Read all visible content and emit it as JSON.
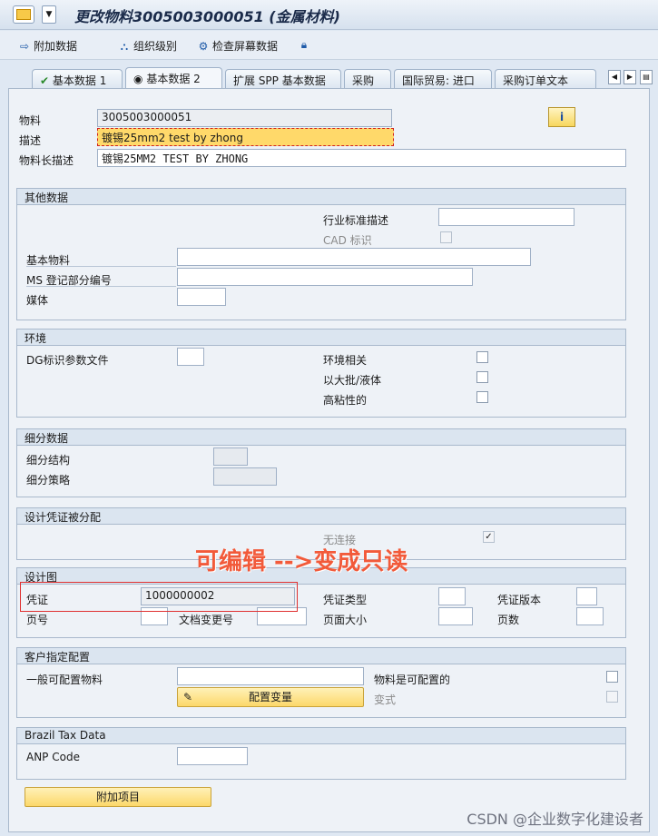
{
  "window": {
    "title": "更改物料3005003000051 (金属材料)"
  },
  "toolbar": {
    "items": [
      {
        "label": "附加数据",
        "icon": "arrow-right-icon"
      },
      {
        "label": "组织级别",
        "icon": "hierarchy-icon"
      },
      {
        "label": "检查屏幕数据",
        "icon": "check-screen-icon"
      },
      {
        "label": "",
        "icon": "lock-icon"
      }
    ]
  },
  "tabs": [
    "基本数据 1",
    "基本数据 2",
    "扩展 SPP 基本数据",
    "采购",
    "国际贸易: 进口",
    "采购订单文本"
  ],
  "header": {
    "material_label": "物料",
    "material_value": "3005003000051",
    "desc_label": "描述",
    "desc_value": "镀锡25mm2 test by zhong",
    "longdesc_label": "物料长描述",
    "longdesc_value": "镀锡25MM2 TEST BY ZHONG"
  },
  "other": {
    "title": "其他数据",
    "industry_desc": "行业标准描述",
    "cad": "CAD 标识",
    "base_material": "基本物料",
    "ms_part": "MS 登记部分编号",
    "medium": "媒体"
  },
  "env": {
    "title": "环境",
    "dg": "DG标识参数文件",
    "env_rel": "环境相关",
    "liquid": "以大批/液体",
    "viscous": "高粘性的"
  },
  "segment": {
    "title": "细分数据",
    "structure": "细分结构",
    "strategy": "细分策略"
  },
  "design_doc": {
    "title": "设计凭证被分配",
    "no_link": "无连接",
    "no_link_checked": "✓"
  },
  "drawing": {
    "title": "设计图",
    "doc": "凭证",
    "doc_value": "1000000002",
    "doc_type": "凭证类型",
    "doc_version": "凭证版本",
    "page_no": "页号",
    "change_no": "文档变更号",
    "page_size": "页面大小",
    "pages": "页数"
  },
  "annotation": "可编辑 -->变成只读",
  "config": {
    "title": "客户指定配置",
    "general": "一般可配置物料",
    "is_config": "物料是可配置的",
    "variant_btn": "配置变量",
    "variant": "变式"
  },
  "brazil": {
    "title": "Brazil Tax Data",
    "anp": "ANP Code"
  },
  "footer": {
    "add_item": "附加项目"
  },
  "watermark": "CSDN @企业数字化建设者"
}
